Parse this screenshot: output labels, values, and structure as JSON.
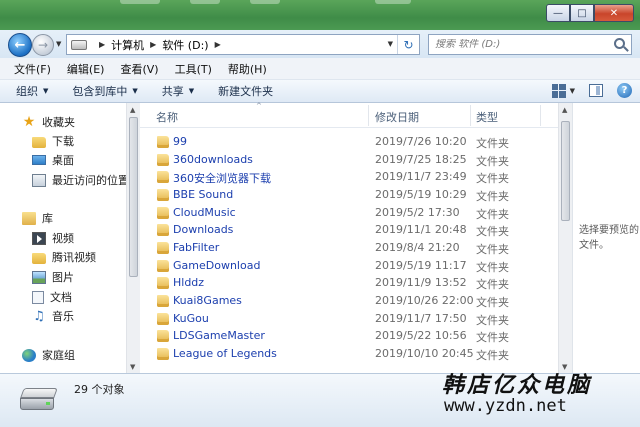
{
  "window": {
    "controls": {
      "minimize": "—",
      "maximize": "□",
      "close": "✕"
    }
  },
  "address": {
    "back_icon": "back-arrow-icon",
    "forward_icon": "forward-arrow-icon",
    "crumbs": [
      "计算机",
      "软件 (D:)"
    ],
    "refresh_icon": "refresh-icon",
    "search_placeholder": "搜索 软件 (D:)"
  },
  "menu": [
    "文件(F)",
    "编辑(E)",
    "查看(V)",
    "工具(T)",
    "帮助(H)"
  ],
  "commands": {
    "organize": "组织",
    "include_library": "包含到库中",
    "share": "共享",
    "new_folder": "新建文件夹"
  },
  "nav": {
    "favorites": "收藏夹",
    "downloads": "下载",
    "desktop": "桌面",
    "recent": "最近访问的位置",
    "libraries": "库",
    "videos": "视频",
    "tencent_video": "腾讯视频",
    "pictures": "图片",
    "documents": "文档",
    "music": "音乐",
    "homegroup": "家庭组"
  },
  "columns": {
    "name": "名称",
    "modified": "修改日期",
    "type": "类型"
  },
  "files": [
    {
      "name": "99",
      "modified": "2019/7/26 10:20",
      "type": "文件夹"
    },
    {
      "name": "360downloads",
      "modified": "2019/7/25 18:25",
      "type": "文件夹"
    },
    {
      "name": "360安全浏览器下载",
      "modified": "2019/11/7 23:49",
      "type": "文件夹"
    },
    {
      "name": "BBE Sound",
      "modified": "2019/5/19 10:29",
      "type": "文件夹"
    },
    {
      "name": "CloudMusic",
      "modified": "2019/5/2 17:30",
      "type": "文件夹"
    },
    {
      "name": "Downloads",
      "modified": "2019/11/1 20:48",
      "type": "文件夹"
    },
    {
      "name": "FabFilter",
      "modified": "2019/8/4 21:20",
      "type": "文件夹"
    },
    {
      "name": "GameDownload",
      "modified": "2019/5/19 11:17",
      "type": "文件夹"
    },
    {
      "name": "Hlddz",
      "modified": "2019/11/9 13:52",
      "type": "文件夹"
    },
    {
      "name": "Kuai8Games",
      "modified": "2019/10/26 22:00",
      "type": "文件夹"
    },
    {
      "name": "KuGou",
      "modified": "2019/11/7 17:50",
      "type": "文件夹"
    },
    {
      "name": "LDSGameMaster",
      "modified": "2019/5/22 10:56",
      "type": "文件夹"
    },
    {
      "name": "League of Legends",
      "modified": "2019/10/10 20:45",
      "type": "文件夹"
    }
  ],
  "preview": {
    "hint": "选择要预览的文件。"
  },
  "status": {
    "count": "29 个对象"
  },
  "watermark": {
    "cn": "韩店亿众电脑",
    "url": "www.yzdn.net"
  },
  "colors": {
    "title_green": "#4b9a52",
    "link_blue": "#1c3fae",
    "folder_yellow": "#e4b44a"
  }
}
